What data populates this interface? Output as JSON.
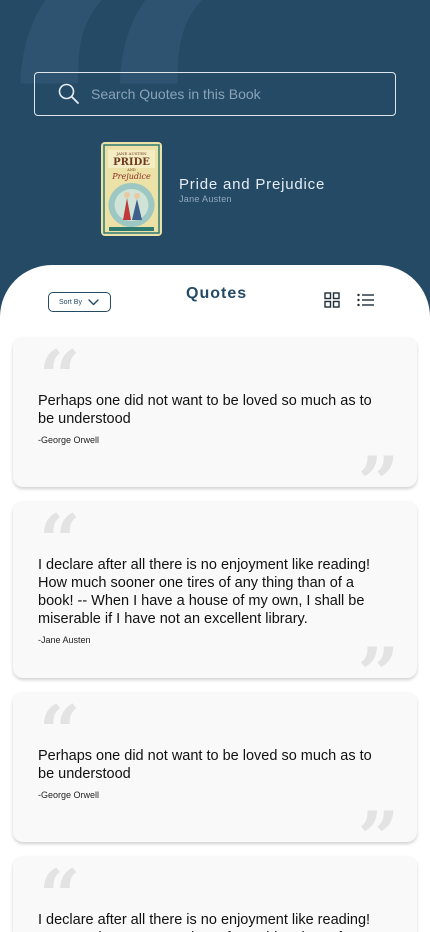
{
  "search": {
    "placeholder": "Search Quotes in this Book"
  },
  "book": {
    "title": "Pride and Prejudice",
    "author": "Jane Austen",
    "cover_text": {
      "author": "JANE AUSTEN",
      "title_top": "PRIDE",
      "and": "AND",
      "title_bottom": "Prejudice"
    }
  },
  "toolbar": {
    "sort_label": "Sort By",
    "section_title": "Quotes"
  },
  "quotes": [
    {
      "text": "Perhaps one did not want to be loved so much as to be understood",
      "author": "-George Orwell"
    },
    {
      "text": "I declare after all there is no enjoyment like reading! How much sooner one tires of any thing than of a book! -- When I have a house of my own, I shall be miserable if I have not an excellent library.",
      "author": "-Jane Austen"
    },
    {
      "text": "Perhaps one did not want to be loved so much as to be understood",
      "author": "-George Orwell"
    },
    {
      "text": "I declare after all there is no enjoyment like reading! How much sooner one tires of any thing than of a",
      "author": ""
    }
  ],
  "colors": {
    "primary": "#254a66",
    "card": "#f9f9f9",
    "quote_mark": "#e3e3e3"
  }
}
